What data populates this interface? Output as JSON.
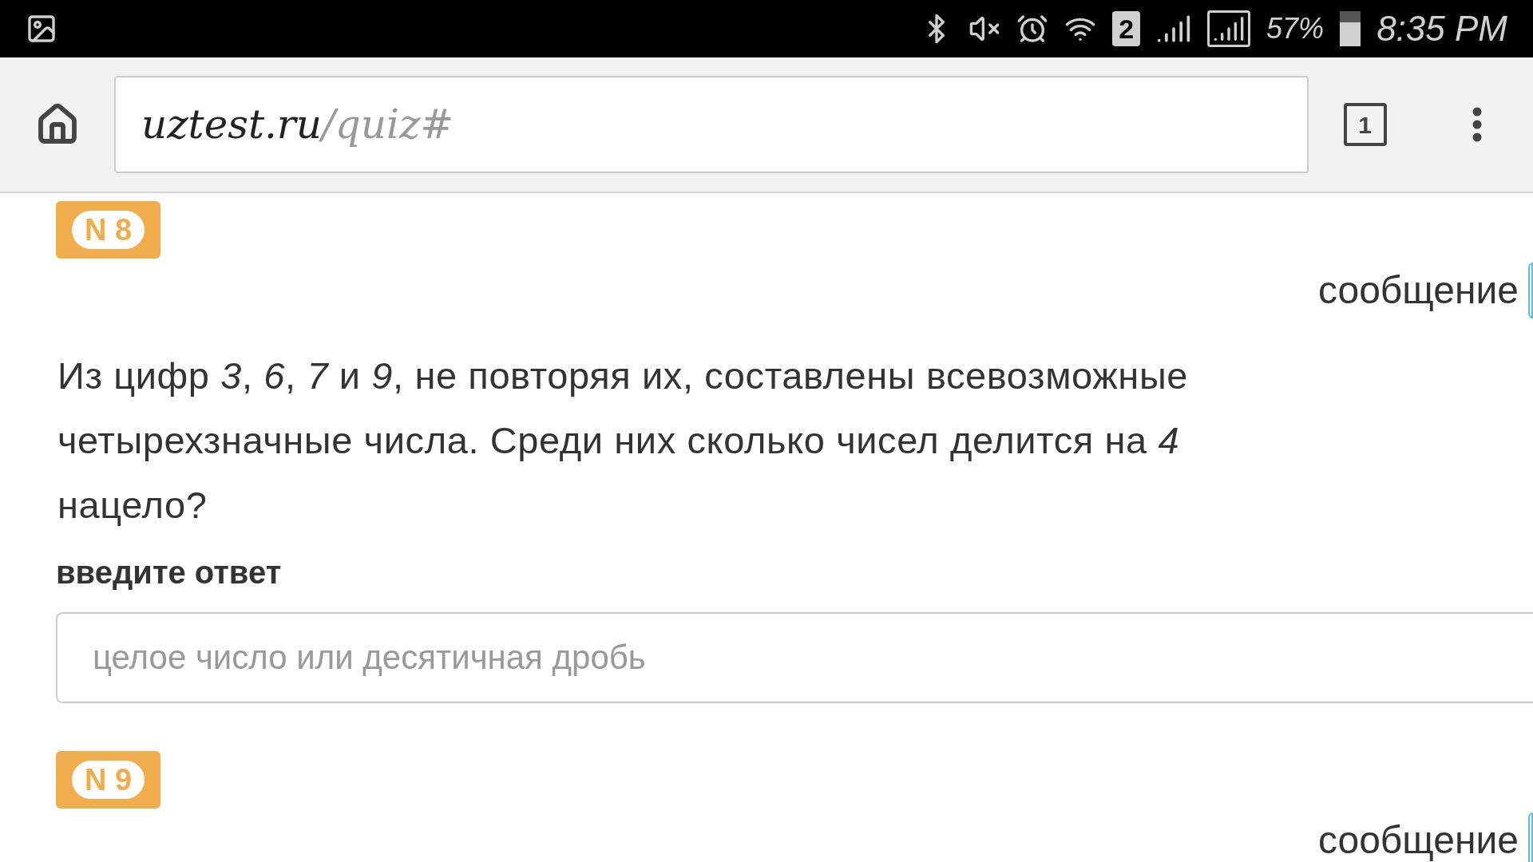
{
  "status_bar": {
    "sim": "2",
    "battery": "57%",
    "time": "8:35 PM"
  },
  "browser": {
    "url_host": "uztest.ru",
    "url_path": "/quiz#",
    "tab_count": "1"
  },
  "questions": [
    {
      "number": "N 8",
      "message": "сообщение",
      "text": "Из цифр *3*, *6*, *7* и *9*, не повторяя их, составлены всевозможные четырехзначные числа. Среди них сколько чисел делится на *4* нацело?",
      "answer_label": "введите ответ",
      "answer_placeholder": "целое число или десятичная дробь"
    },
    {
      "number": "N 9",
      "message": "сообщение"
    }
  ]
}
